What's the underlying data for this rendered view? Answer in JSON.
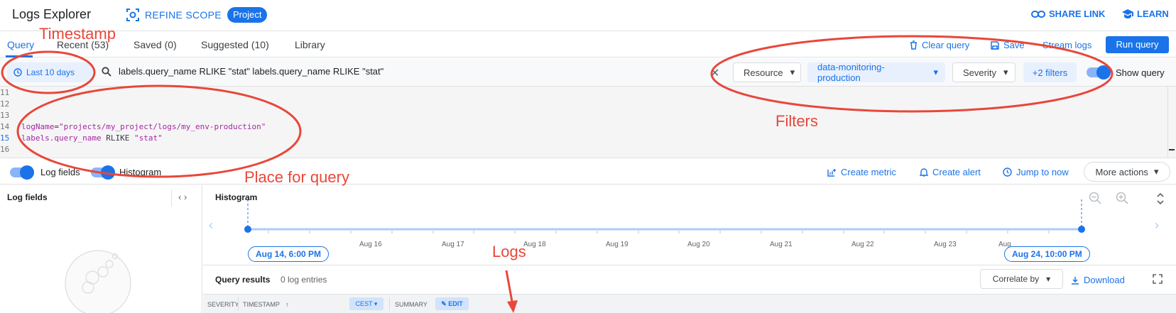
{
  "header": {
    "app_title": "Logs Explorer",
    "refine_label": "REFINE SCOPE",
    "project_badge": "Project",
    "share_label": "SHARE LINK",
    "learn_label": "LEARN"
  },
  "tabs": {
    "items": [
      {
        "label": "Query",
        "active": true
      },
      {
        "label": "Recent (53)"
      },
      {
        "label": "Saved (0)"
      },
      {
        "label": "Suggested (10)"
      },
      {
        "label": "Library"
      }
    ],
    "clear_label": "Clear query",
    "save_label": "Save",
    "stream_label": "Stream logs",
    "run_label": "Run query"
  },
  "filters": {
    "time_range": "Last 10 days",
    "query_text": "labels.query_name RLIKE \"stat\" labels.query_name RLIKE \"stat\"",
    "resource": "Resource",
    "project": "data-monitoring-production",
    "severity": "Severity",
    "more_filters": "+2 filters",
    "show_query": "Show query"
  },
  "editor": {
    "lines": [
      {
        "n": "11",
        "code": ""
      },
      {
        "n": "12",
        "code": ""
      },
      {
        "n": "13",
        "code": ""
      },
      {
        "n": "14",
        "field": "logName",
        "op": "=",
        "value": "\"projects/my_project/logs/my_env-production\""
      },
      {
        "n": "15",
        "field": "labels.query_name",
        "op": " RLIKE ",
        "value": "\"stat\""
      },
      {
        "n": "16",
        "code": ""
      }
    ]
  },
  "view_row": {
    "log_fields_toggle": "Log fields",
    "histogram_toggle": "Histogram",
    "create_metric": "Create metric",
    "create_alert": "Create alert",
    "jump_to_now": "Jump to now",
    "more_actions": "More actions"
  },
  "left_panel": {
    "title": "Log fields",
    "collapse_icon": "code-brackets-icon"
  },
  "histogram": {
    "title": "Histogram",
    "start_pill": "Aug 14, 6:00 PM",
    "end_pill": "Aug 24, 10:00 PM",
    "dates": [
      "Aug 16",
      "Aug 17",
      "Aug 18",
      "Aug 19",
      "Aug 20",
      "Aug 21",
      "Aug 22",
      "Aug 23",
      "Aug"
    ]
  },
  "results": {
    "title": "Query results",
    "count": "0 log entries",
    "correlate": "Correlate by",
    "download": "Download",
    "columns": {
      "severity": "SEVERITY",
      "timestamp": "TIMESTAMP",
      "timezone": "CEST",
      "summary": "SUMMARY",
      "edit": "EDIT"
    }
  },
  "annotations": {
    "timestamp": "Timestamp",
    "filters": "Filters",
    "place_for_query": "Place for query",
    "logs": "Logs",
    "color": "#e8473a"
  },
  "colors": {
    "accent": "#1a73e8",
    "annotation": "#e8473a"
  }
}
